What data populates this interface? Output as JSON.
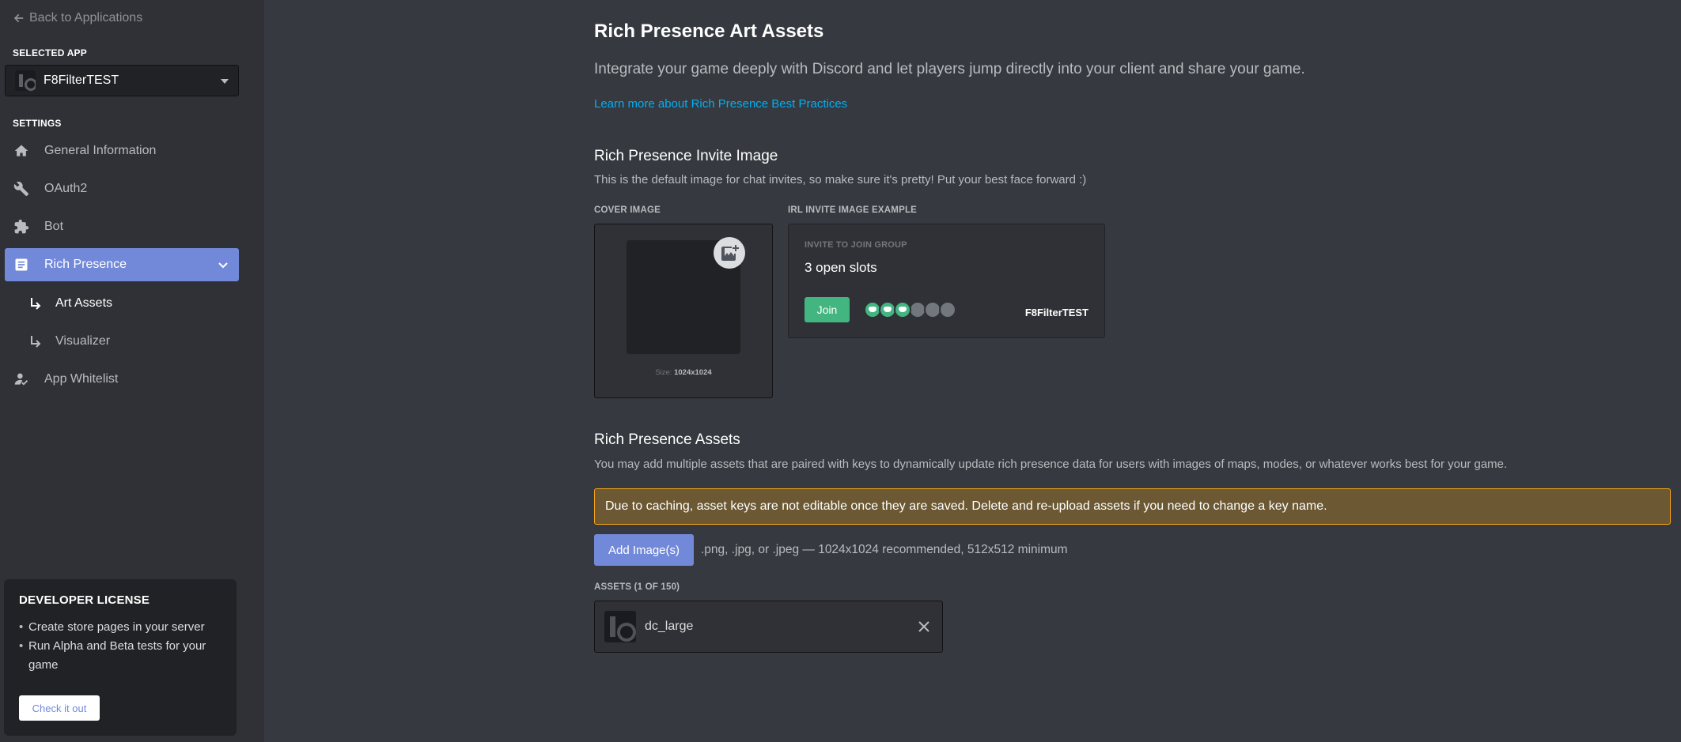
{
  "sidebar": {
    "back_label": "Back to Applications",
    "selected_app_label": "SELECTED APP",
    "app_name": "F8FilterTEST",
    "settings_label": "SETTINGS",
    "items": [
      {
        "label": "General Information",
        "icon": "home-icon"
      },
      {
        "label": "OAuth2",
        "icon": "wrench-icon"
      },
      {
        "label": "Bot",
        "icon": "puzzle-icon"
      },
      {
        "label": "Rich Presence",
        "icon": "document-icon",
        "active": true
      },
      {
        "label": "App Whitelist",
        "icon": "user-check-icon"
      }
    ],
    "sub_items": [
      {
        "label": "Art Assets",
        "active": true
      },
      {
        "label": "Visualizer"
      }
    ],
    "dev_license": {
      "title": "DEVELOPER LICENSE",
      "bullet1": "Create store pages in your server",
      "bullet2": "Run Alpha and Beta tests for your game",
      "button": "Check it out"
    }
  },
  "main": {
    "title": "Rich Presence Art Assets",
    "description": "Integrate your game deeply with Discord and let players jump directly into your client and share your game.",
    "learn_link": "Learn more about Rich Presence Best Practices",
    "invite_section": {
      "title": "Rich Presence Invite Image",
      "description": "This is the default image for chat invites, so make sure it's pretty! Put your best face forward :)",
      "cover_label": "COVER IMAGE",
      "cover_size_prefix": "Size:",
      "cover_size_value": "1024x1024",
      "example_label": "IRL INVITE IMAGE EXAMPLE",
      "invite_header": "INVITE TO JOIN GROUP",
      "slots": "3 open slots",
      "join_button": "Join",
      "app_name": "F8FilterTEST",
      "avatars_filled": 3,
      "avatars_empty": 3
    },
    "assets_section": {
      "title": "Rich Presence Assets",
      "description": "You may add multiple assets that are paired with keys to dynamically update rich presence data for users with images of maps, modes, or whatever works best for your game.",
      "warning": "Due to caching, asset keys are not editable once they are saved. Delete and re-upload assets if you need to change a key name.",
      "add_button": "Add Image(s)",
      "add_hint": ".png, .jpg, or .jpeg — 1024x1024 recommended, 512x512 minimum",
      "assets_label": "ASSETS (1 OF 150)",
      "assets": [
        {
          "name": "dc_large"
        }
      ]
    }
  },
  "colors": {
    "accent": "#7289da",
    "success": "#43b581",
    "link": "#00b0f4",
    "warning_border": "#faa61a",
    "warning_bg": "#6c5833"
  }
}
